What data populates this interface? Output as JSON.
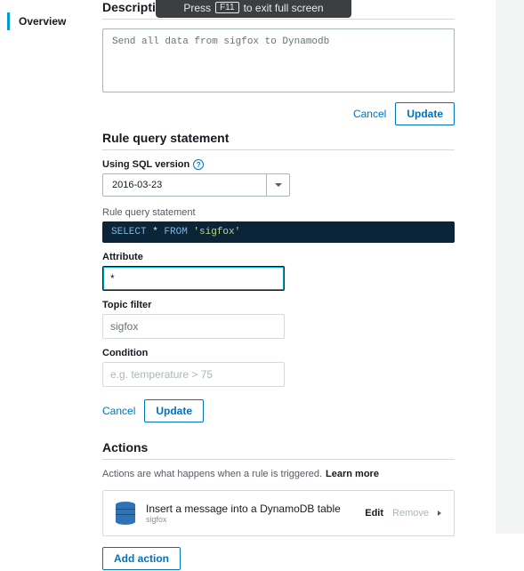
{
  "fs_banner": {
    "press": "Press",
    "key": "F11",
    "rest": "to exit full screen"
  },
  "nav": {
    "overview": "Overview"
  },
  "description": {
    "heading": "Description",
    "value": "Send all data from sigfox to Dynamodb",
    "cancel": "Cancel",
    "update": "Update"
  },
  "rqs": {
    "heading": "Rule query statement",
    "sql_version_label": "Using SQL version",
    "sql_version_value": "2016-03-23",
    "statement_label": "Rule query statement",
    "sql_select": "SELECT",
    "sql_star": " * ",
    "sql_from": "FROM",
    "sql_topic": " 'sigfox'",
    "attribute_label": "Attribute",
    "attribute_value": "*",
    "topic_label": "Topic filter",
    "topic_value": "sigfox",
    "condition_label": "Condition",
    "condition_placeholder": "e.g. temperature > 75",
    "cancel": "Cancel",
    "update": "Update"
  },
  "actions": {
    "heading": "Actions",
    "hint": "Actions are what happens when a rule is triggered.",
    "learn": "Learn more",
    "item": {
      "title": "Insert a message into a DynamoDB table",
      "sub": "sigfox"
    },
    "edit": "Edit",
    "remove": "Remove",
    "add": "Add action"
  }
}
